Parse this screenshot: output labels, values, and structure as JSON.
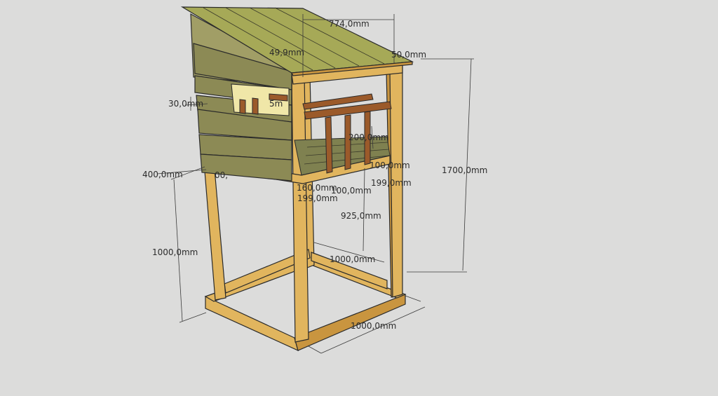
{
  "dimensions": {
    "roof_width": "774,0mm",
    "roof_overhang_left": "49,9mm",
    "roof_overhang_right": "50,0mm",
    "total_height": "1700,0mm",
    "window_gap": "30,0mm",
    "window_label": "5m",
    "railing_height": "200,0mm",
    "wall_depth": "400,0mm",
    "wall_left_cut": "00,",
    "floor_beam_a": "100,0mm",
    "floor_beam_b": "199,0mm",
    "floor_beam_c": "160,0mm",
    "floor_beam_d": "100,0mm",
    "floor_beam_e": "199,0mm",
    "platform_height": "925,0mm",
    "leg_height": "1000,0mm",
    "base_depth": "1000,0mm",
    "base_width": "1000,0mm"
  },
  "colors": {
    "background": "#dcdcdb",
    "frame_wood": "#e1b55e",
    "wall_wood": "#8c8a55",
    "roof_wood": "#a6a957",
    "stained_wood": "#9b5a2a"
  }
}
